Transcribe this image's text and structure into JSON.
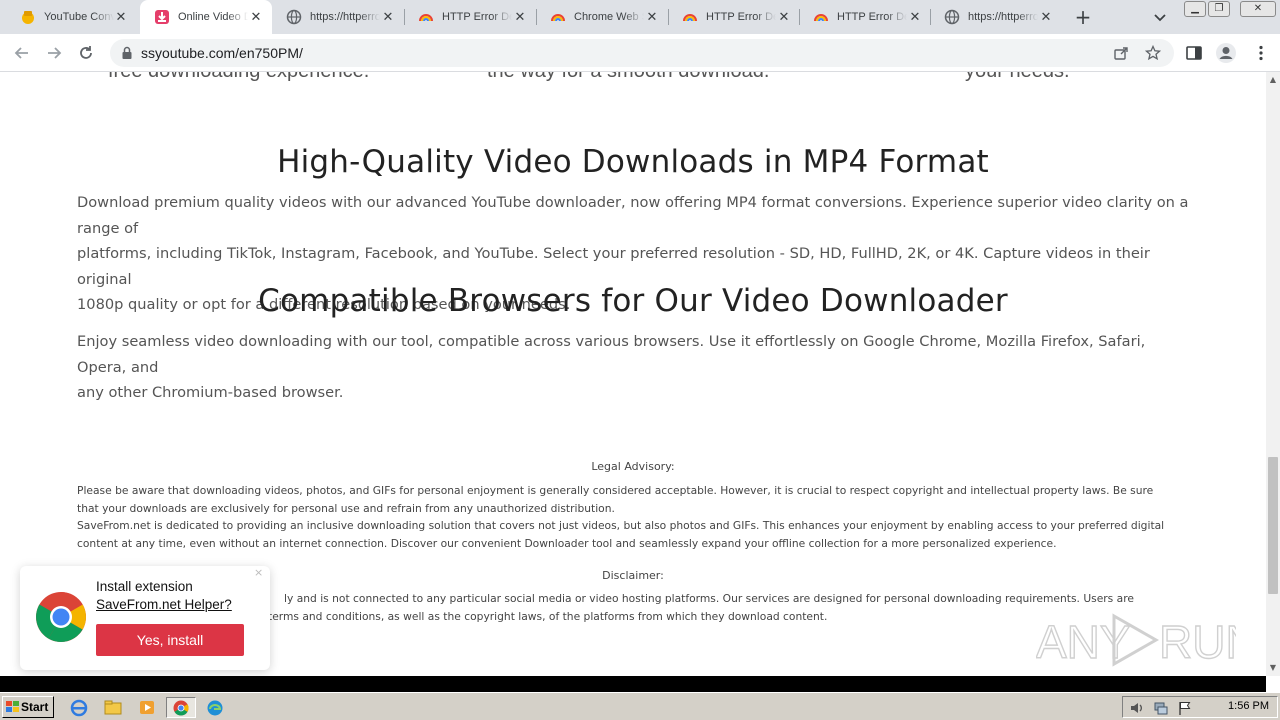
{
  "browser": {
    "tabs": [
      {
        "title": "YouTube Converter",
        "icon": "youtube-converter-favicon"
      },
      {
        "title": "Online Video Downloader",
        "icon": "savefrom-favicon",
        "active": true
      },
      {
        "title": "https://httperrors",
        "icon": "globe-icon"
      },
      {
        "title": "HTTP Error Details",
        "icon": "rainbow-favicon"
      },
      {
        "title": "Chrome Web Store",
        "icon": "rainbow-favicon"
      },
      {
        "title": "HTTP Error Details",
        "icon": "rainbow-favicon"
      },
      {
        "title": "HTTP Error Details",
        "icon": "rainbow-favicon"
      },
      {
        "title": "https://httperrors",
        "icon": "globe-icon"
      }
    ],
    "url": "ssyoutube.com/en750PM/"
  },
  "page": {
    "cut_texts": [
      "free downloading experience.",
      "the way for a smooth download.",
      "your needs."
    ],
    "section1": {
      "heading": "High-Quality Video Downloads in MP4 Format",
      "lines": [
        "Download premium quality videos with our advanced YouTube downloader, now offering MP4 format conversions. Experience superior video clarity on a range of",
        "platforms, including TikTok, Instagram, Facebook, and YouTube. Select your preferred resolution - SD, HD, FullHD, 2K, or 4K. Capture videos in their original",
        "1080p quality or opt for a different resolution based on your needs."
      ]
    },
    "section2": {
      "heading": "Compatible Browsers for Our Video Downloader",
      "lines": [
        "Enjoy seamless video downloading with our tool, compatible across various browsers. Use it effortlessly on Google Chrome, Mozilla Firefox, Safari, Opera, and",
        "any other Chromium-based browser."
      ]
    },
    "legal": {
      "title": "Legal Advisory:",
      "lines": [
        "Please be aware that downloading videos, photos, and GIFs for personal enjoyment is generally considered acceptable. However, it is crucial to respect copyright and intellectual property laws. Be sure",
        "that your downloads are exclusively for personal use and refrain from any unauthorized distribution.",
        "SaveFrom.net is dedicated to providing an inclusive downloading solution that covers not just videos, but also photos and GIFs. This enhances your enjoyment by enabling access to your preferred digital",
        "content at any time, even without an internet connection. Discover our convenient Downloader tool and seamlessly expand your offline collection for a more personalized experience."
      ]
    },
    "disclaimer": {
      "title": "Disclaimer:",
      "lines": [
        "ly and is not connected to any particular social media or video hosting platforms. Our services are designed for personal downloading requirements. Users are",
        "terms and conditions, as well as the copyright laws, of the platforms from which they download content."
      ]
    }
  },
  "popup": {
    "line1": "Install extension",
    "line2": "SaveFrom.net Helper?",
    "button": "Yes, install",
    "close": "×"
  },
  "taskbar": {
    "start": "Start",
    "clock": "1:56 PM"
  },
  "watermark": "ANY RUN",
  "colors": {
    "accent_red": "#dc3545",
    "tab_strip": "#dee1e6",
    "taskbar": "#d4d0c8"
  }
}
